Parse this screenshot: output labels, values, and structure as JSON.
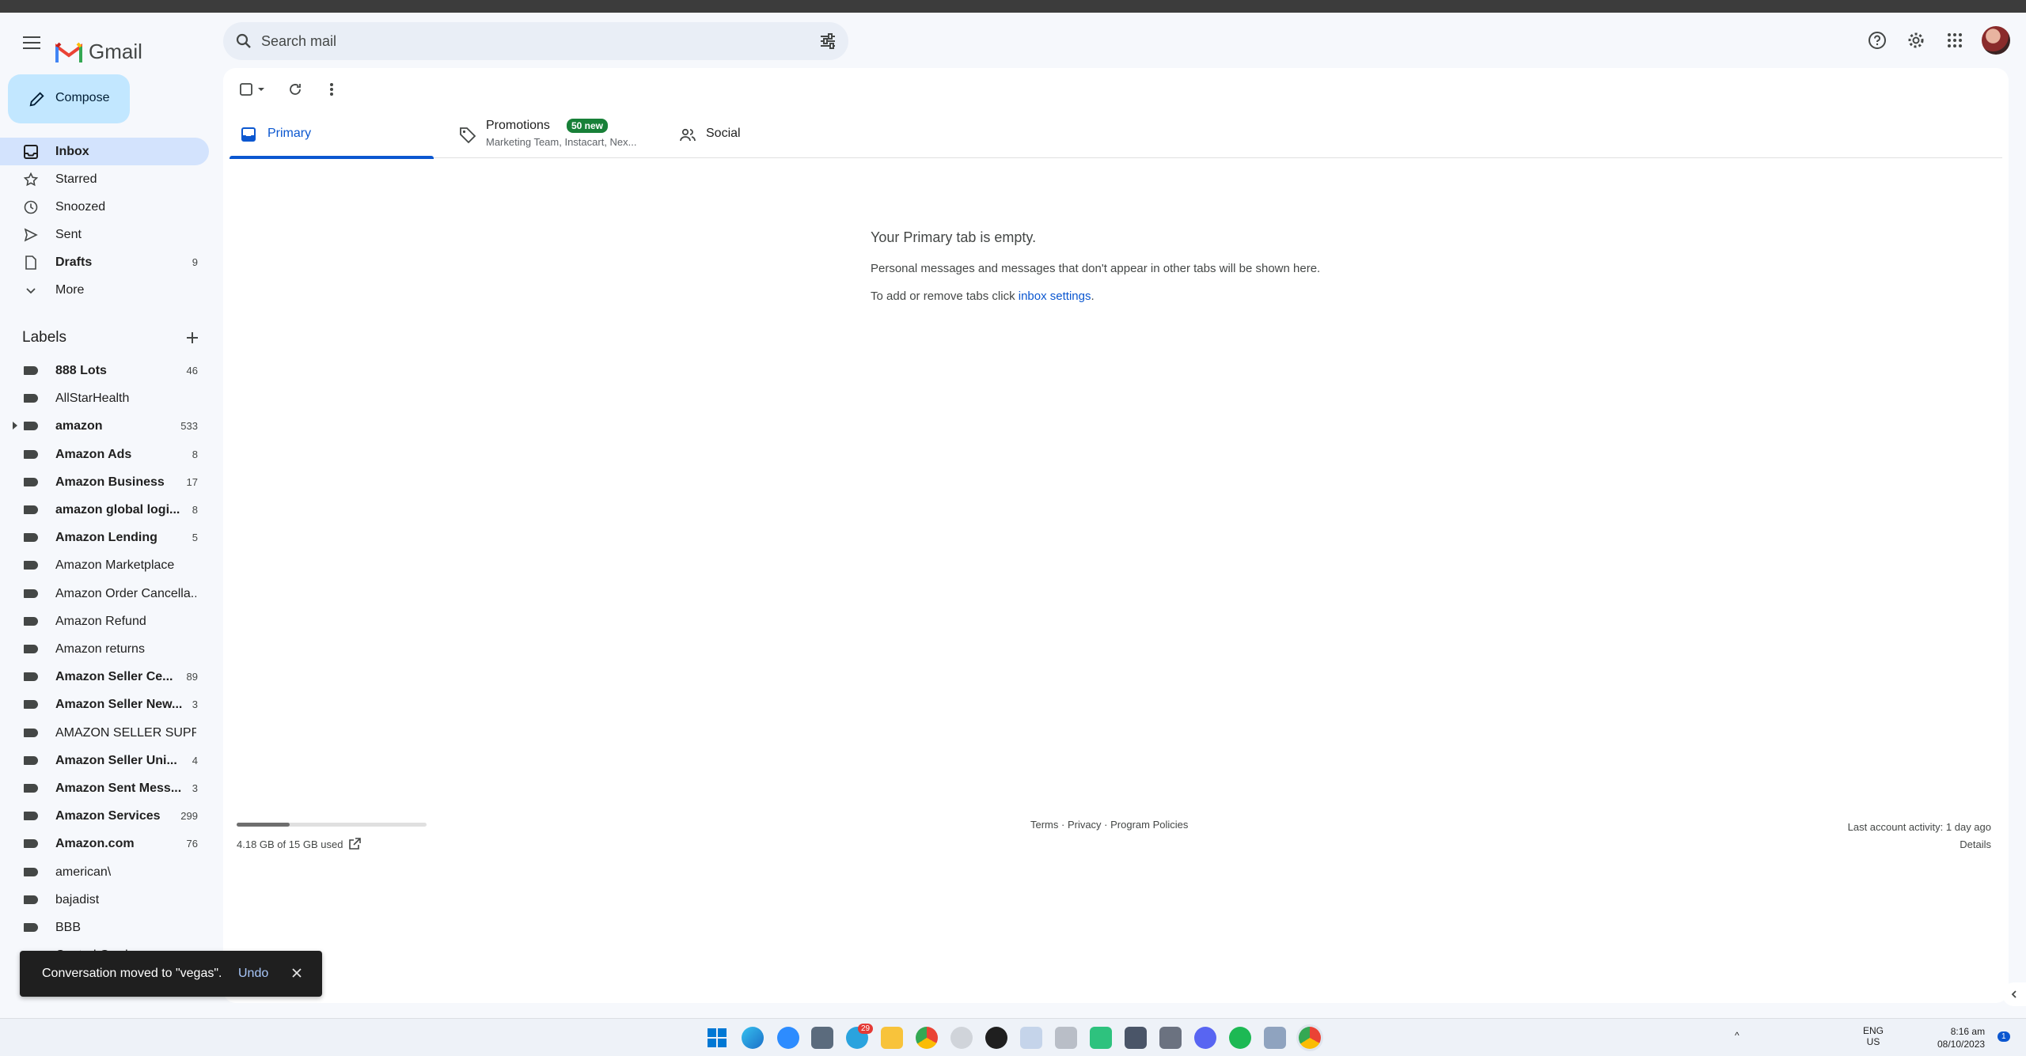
{
  "app": {
    "name": "Gmail"
  },
  "search": {
    "placeholder": "Search mail"
  },
  "compose": {
    "label": "Compose"
  },
  "nav": [
    {
      "label": "Inbox",
      "count": "",
      "active": true,
      "bold": true,
      "icon": "inbox-icon"
    },
    {
      "label": "Starred",
      "count": "",
      "icon": "star-icon"
    },
    {
      "label": "Snoozed",
      "count": "",
      "icon": "clock-icon"
    },
    {
      "label": "Sent",
      "count": "",
      "icon": "send-icon"
    },
    {
      "label": "Drafts",
      "count": "9",
      "bold": true,
      "icon": "draft-icon"
    },
    {
      "label": "More",
      "count": "",
      "icon": "chevron-down-icon"
    }
  ],
  "labels": {
    "heading": "Labels",
    "items": [
      {
        "label": "888 Lots",
        "count": "46",
        "bold": true
      },
      {
        "label": "AllStarHealth",
        "count": ""
      },
      {
        "label": "amazon",
        "count": "533",
        "bold": true,
        "expandable": true
      },
      {
        "label": "Amazon Ads",
        "count": "8",
        "bold": true
      },
      {
        "label": "Amazon Business",
        "count": "17",
        "bold": true
      },
      {
        "label": "amazon global logi...",
        "count": "8",
        "bold": true
      },
      {
        "label": "Amazon Lending",
        "count": "5",
        "bold": true
      },
      {
        "label": "Amazon Marketplace",
        "count": ""
      },
      {
        "label": "Amazon Order Cancella...",
        "count": ""
      },
      {
        "label": "Amazon Refund",
        "count": ""
      },
      {
        "label": "Amazon returns",
        "count": ""
      },
      {
        "label": "Amazon Seller Ce...",
        "count": "89",
        "bold": true
      },
      {
        "label": "Amazon Seller New...",
        "count": "3",
        "bold": true
      },
      {
        "label": "AMAZON SELLER SUPP...",
        "count": ""
      },
      {
        "label": "Amazon Seller Uni...",
        "count": "4",
        "bold": true
      },
      {
        "label": "Amazon Sent Mess...",
        "count": "3",
        "bold": true
      },
      {
        "label": "Amazon Services",
        "count": "299",
        "bold": true
      },
      {
        "label": "Amazon.com",
        "count": "76",
        "bold": true
      },
      {
        "label": "american\\",
        "count": ""
      },
      {
        "label": "bajadist",
        "count": ""
      },
      {
        "label": "BBB",
        "count": ""
      },
      {
        "label": "Central Garden",
        "count": ""
      }
    ]
  },
  "tabs": [
    {
      "label": "Primary",
      "active": true
    },
    {
      "label": "Promotions",
      "badge": "50 new",
      "subtitle": "Marketing Team, Instacart, Nex..."
    },
    {
      "label": "Social"
    }
  ],
  "empty_state": {
    "title": "Your Primary tab is empty.",
    "line1": "Personal messages and messages that don't appear in other tabs will be shown here.",
    "line2_prefix": "To add or remove tabs click ",
    "line2_link": "inbox settings",
    "line2_suffix": "."
  },
  "storage": {
    "text": "4.18 GB of 15 GB used",
    "used_fraction": 0.279
  },
  "footer": {
    "links": "Terms · Privacy · Program Policies",
    "activity": "Last account activity: 1 day ago",
    "details": "Details"
  },
  "toast": {
    "message": "Conversation moved to \"vegas\".",
    "action": "Undo"
  },
  "taskbar": {
    "lang1": "ENG",
    "lang2": "US",
    "time": "8:16 am",
    "date": "08/10/2023",
    "notifications": "1",
    "telegram_badge": "29"
  },
  "colors": {
    "accent": "#0b57d0",
    "compose_bg": "#c2e7ff",
    "active_nav": "#d3e3fd",
    "badge": "#188038"
  }
}
